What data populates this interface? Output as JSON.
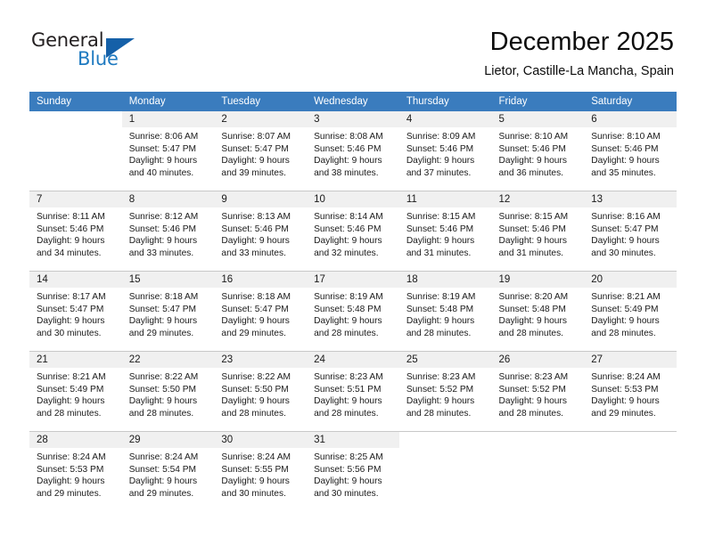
{
  "brand": {
    "name_top": "General",
    "name_bottom": "Blue",
    "accent_color": "#1560a8",
    "text_color": "#231f20"
  },
  "header": {
    "title": "December 2025",
    "subtitle": "Lietor, Castille-La Mancha, Spain"
  },
  "calendar": {
    "header_bg": "#3a7cbe",
    "header_text_color": "#ffffff",
    "daynum_band_bg": "#f0f0f0",
    "grid_line_color": "#c8c8c8",
    "weekday_headers": [
      "Sunday",
      "Monday",
      "Tuesday",
      "Wednesday",
      "Thursday",
      "Friday",
      "Saturday"
    ],
    "weeks": [
      [
        {
          "day": "",
          "blank": true,
          "sunrise": "",
          "sunset": "",
          "daylight_l1": "",
          "daylight_l2": ""
        },
        {
          "day": "1",
          "sunrise": "Sunrise: 8:06 AM",
          "sunset": "Sunset: 5:47 PM",
          "daylight_l1": "Daylight: 9 hours",
          "daylight_l2": "and 40 minutes."
        },
        {
          "day": "2",
          "sunrise": "Sunrise: 8:07 AM",
          "sunset": "Sunset: 5:47 PM",
          "daylight_l1": "Daylight: 9 hours",
          "daylight_l2": "and 39 minutes."
        },
        {
          "day": "3",
          "sunrise": "Sunrise: 8:08 AM",
          "sunset": "Sunset: 5:46 PM",
          "daylight_l1": "Daylight: 9 hours",
          "daylight_l2": "and 38 minutes."
        },
        {
          "day": "4",
          "sunrise": "Sunrise: 8:09 AM",
          "sunset": "Sunset: 5:46 PM",
          "daylight_l1": "Daylight: 9 hours",
          "daylight_l2": "and 37 minutes."
        },
        {
          "day": "5",
          "sunrise": "Sunrise: 8:10 AM",
          "sunset": "Sunset: 5:46 PM",
          "daylight_l1": "Daylight: 9 hours",
          "daylight_l2": "and 36 minutes."
        },
        {
          "day": "6",
          "sunrise": "Sunrise: 8:10 AM",
          "sunset": "Sunset: 5:46 PM",
          "daylight_l1": "Daylight: 9 hours",
          "daylight_l2": "and 35 minutes."
        }
      ],
      [
        {
          "day": "7",
          "sunrise": "Sunrise: 8:11 AM",
          "sunset": "Sunset: 5:46 PM",
          "daylight_l1": "Daylight: 9 hours",
          "daylight_l2": "and 34 minutes."
        },
        {
          "day": "8",
          "sunrise": "Sunrise: 8:12 AM",
          "sunset": "Sunset: 5:46 PM",
          "daylight_l1": "Daylight: 9 hours",
          "daylight_l2": "and 33 minutes."
        },
        {
          "day": "9",
          "sunrise": "Sunrise: 8:13 AM",
          "sunset": "Sunset: 5:46 PM",
          "daylight_l1": "Daylight: 9 hours",
          "daylight_l2": "and 33 minutes."
        },
        {
          "day": "10",
          "sunrise": "Sunrise: 8:14 AM",
          "sunset": "Sunset: 5:46 PM",
          "daylight_l1": "Daylight: 9 hours",
          "daylight_l2": "and 32 minutes."
        },
        {
          "day": "11",
          "sunrise": "Sunrise: 8:15 AM",
          "sunset": "Sunset: 5:46 PM",
          "daylight_l1": "Daylight: 9 hours",
          "daylight_l2": "and 31 minutes."
        },
        {
          "day": "12",
          "sunrise": "Sunrise: 8:15 AM",
          "sunset": "Sunset: 5:46 PM",
          "daylight_l1": "Daylight: 9 hours",
          "daylight_l2": "and 31 minutes."
        },
        {
          "day": "13",
          "sunrise": "Sunrise: 8:16 AM",
          "sunset": "Sunset: 5:47 PM",
          "daylight_l1": "Daylight: 9 hours",
          "daylight_l2": "and 30 minutes."
        }
      ],
      [
        {
          "day": "14",
          "sunrise": "Sunrise: 8:17 AM",
          "sunset": "Sunset: 5:47 PM",
          "daylight_l1": "Daylight: 9 hours",
          "daylight_l2": "and 30 minutes."
        },
        {
          "day": "15",
          "sunrise": "Sunrise: 8:18 AM",
          "sunset": "Sunset: 5:47 PM",
          "daylight_l1": "Daylight: 9 hours",
          "daylight_l2": "and 29 minutes."
        },
        {
          "day": "16",
          "sunrise": "Sunrise: 8:18 AM",
          "sunset": "Sunset: 5:47 PM",
          "daylight_l1": "Daylight: 9 hours",
          "daylight_l2": "and 29 minutes."
        },
        {
          "day": "17",
          "sunrise": "Sunrise: 8:19 AM",
          "sunset": "Sunset: 5:48 PM",
          "daylight_l1": "Daylight: 9 hours",
          "daylight_l2": "and 28 minutes."
        },
        {
          "day": "18",
          "sunrise": "Sunrise: 8:19 AM",
          "sunset": "Sunset: 5:48 PM",
          "daylight_l1": "Daylight: 9 hours",
          "daylight_l2": "and 28 minutes."
        },
        {
          "day": "19",
          "sunrise": "Sunrise: 8:20 AM",
          "sunset": "Sunset: 5:48 PM",
          "daylight_l1": "Daylight: 9 hours",
          "daylight_l2": "and 28 minutes."
        },
        {
          "day": "20",
          "sunrise": "Sunrise: 8:21 AM",
          "sunset": "Sunset: 5:49 PM",
          "daylight_l1": "Daylight: 9 hours",
          "daylight_l2": "and 28 minutes."
        }
      ],
      [
        {
          "day": "21",
          "sunrise": "Sunrise: 8:21 AM",
          "sunset": "Sunset: 5:49 PM",
          "daylight_l1": "Daylight: 9 hours",
          "daylight_l2": "and 28 minutes."
        },
        {
          "day": "22",
          "sunrise": "Sunrise: 8:22 AM",
          "sunset": "Sunset: 5:50 PM",
          "daylight_l1": "Daylight: 9 hours",
          "daylight_l2": "and 28 minutes."
        },
        {
          "day": "23",
          "sunrise": "Sunrise: 8:22 AM",
          "sunset": "Sunset: 5:50 PM",
          "daylight_l1": "Daylight: 9 hours",
          "daylight_l2": "and 28 minutes."
        },
        {
          "day": "24",
          "sunrise": "Sunrise: 8:23 AM",
          "sunset": "Sunset: 5:51 PM",
          "daylight_l1": "Daylight: 9 hours",
          "daylight_l2": "and 28 minutes."
        },
        {
          "day": "25",
          "sunrise": "Sunrise: 8:23 AM",
          "sunset": "Sunset: 5:52 PM",
          "daylight_l1": "Daylight: 9 hours",
          "daylight_l2": "and 28 minutes."
        },
        {
          "day": "26",
          "sunrise": "Sunrise: 8:23 AM",
          "sunset": "Sunset: 5:52 PM",
          "daylight_l1": "Daylight: 9 hours",
          "daylight_l2": "and 28 minutes."
        },
        {
          "day": "27",
          "sunrise": "Sunrise: 8:24 AM",
          "sunset": "Sunset: 5:53 PM",
          "daylight_l1": "Daylight: 9 hours",
          "daylight_l2": "and 29 minutes."
        }
      ],
      [
        {
          "day": "28",
          "sunrise": "Sunrise: 8:24 AM",
          "sunset": "Sunset: 5:53 PM",
          "daylight_l1": "Daylight: 9 hours",
          "daylight_l2": "and 29 minutes."
        },
        {
          "day": "29",
          "sunrise": "Sunrise: 8:24 AM",
          "sunset": "Sunset: 5:54 PM",
          "daylight_l1": "Daylight: 9 hours",
          "daylight_l2": "and 29 minutes."
        },
        {
          "day": "30",
          "sunrise": "Sunrise: 8:24 AM",
          "sunset": "Sunset: 5:55 PM",
          "daylight_l1": "Daylight: 9 hours",
          "daylight_l2": "and 30 minutes."
        },
        {
          "day": "31",
          "sunrise": "Sunrise: 8:25 AM",
          "sunset": "Sunset: 5:56 PM",
          "daylight_l1": "Daylight: 9 hours",
          "daylight_l2": "and 30 minutes."
        },
        {
          "day": "",
          "blank": true,
          "sunrise": "",
          "sunset": "",
          "daylight_l1": "",
          "daylight_l2": ""
        },
        {
          "day": "",
          "blank": true,
          "sunrise": "",
          "sunset": "",
          "daylight_l1": "",
          "daylight_l2": ""
        },
        {
          "day": "",
          "blank": true,
          "sunrise": "",
          "sunset": "",
          "daylight_l1": "",
          "daylight_l2": ""
        }
      ]
    ]
  }
}
